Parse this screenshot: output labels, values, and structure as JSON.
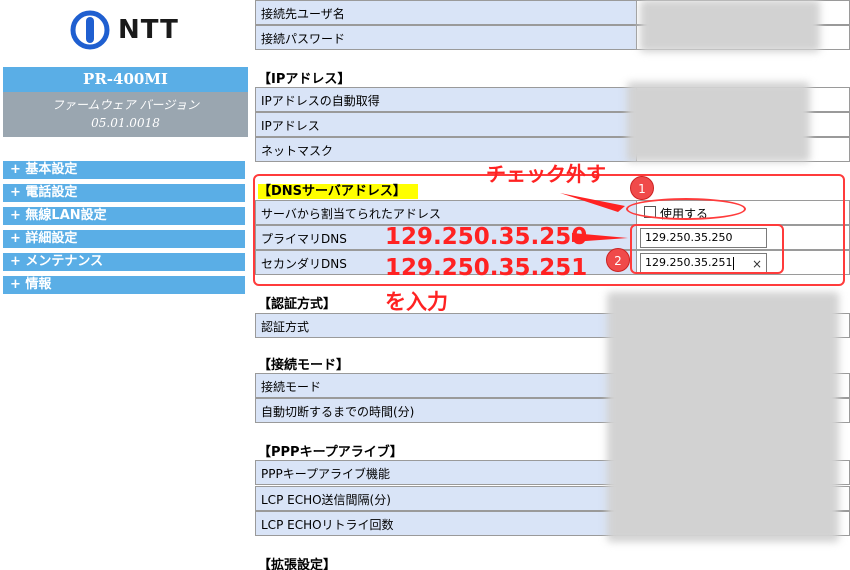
{
  "sidebar": {
    "logo_text": "NTT",
    "model": "PR-400MI",
    "firmware_label": "ファームウェア バージョン",
    "firmware_version": "05.01.0018",
    "nav": [
      {
        "label": "+ 基本設定"
      },
      {
        "label": "+ 電話設定"
      },
      {
        "label": "+ 無線LAN設定"
      },
      {
        "label": "+ 詳細設定"
      },
      {
        "label": "+ メンテナンス"
      },
      {
        "label": "+ 情報"
      }
    ]
  },
  "connection": {
    "user_label": "接続先ユーザ名",
    "password_label": "接続パスワード"
  },
  "ip": {
    "title": "【IPアドレス】",
    "auto_label": "IPアドレスの自動取得",
    "ip_label": "IPアドレス",
    "mask_label": "ネットマスク"
  },
  "dns": {
    "title": "【DNSサーバアドレス】",
    "assigned_label": "サーバから割当てられたアドレス",
    "use_label": "使用する",
    "use_checked": false,
    "primary_label": "プライマリDNS",
    "primary_value": "129.250.35.250",
    "secondary_label": "セカンダリDNS",
    "secondary_value": "129.250.35.251",
    "clear_symbol": "×"
  },
  "auth": {
    "title": "【認証方式】",
    "label": "認証方式"
  },
  "conn_mode": {
    "title": "【接続モード】",
    "mode_label": "接続モード",
    "timeout_label": "自動切断するまでの時間(分)"
  },
  "keepalive": {
    "title": "【PPPキープアライブ】",
    "func_label": "PPPキープアライブ機能",
    "interval_label": "LCP ECHO送信間隔(分)",
    "retry_label": "LCP ECHOリトライ回数"
  },
  "ext": {
    "title": "【拡張設定】"
  },
  "annotations": {
    "uncheck": "チェック外す",
    "primary": "129.250.35.250",
    "secondary": "129.250.35.251",
    "enter": "を入力",
    "badge1": "1",
    "badge2": "2",
    "color": "#ff2222"
  }
}
